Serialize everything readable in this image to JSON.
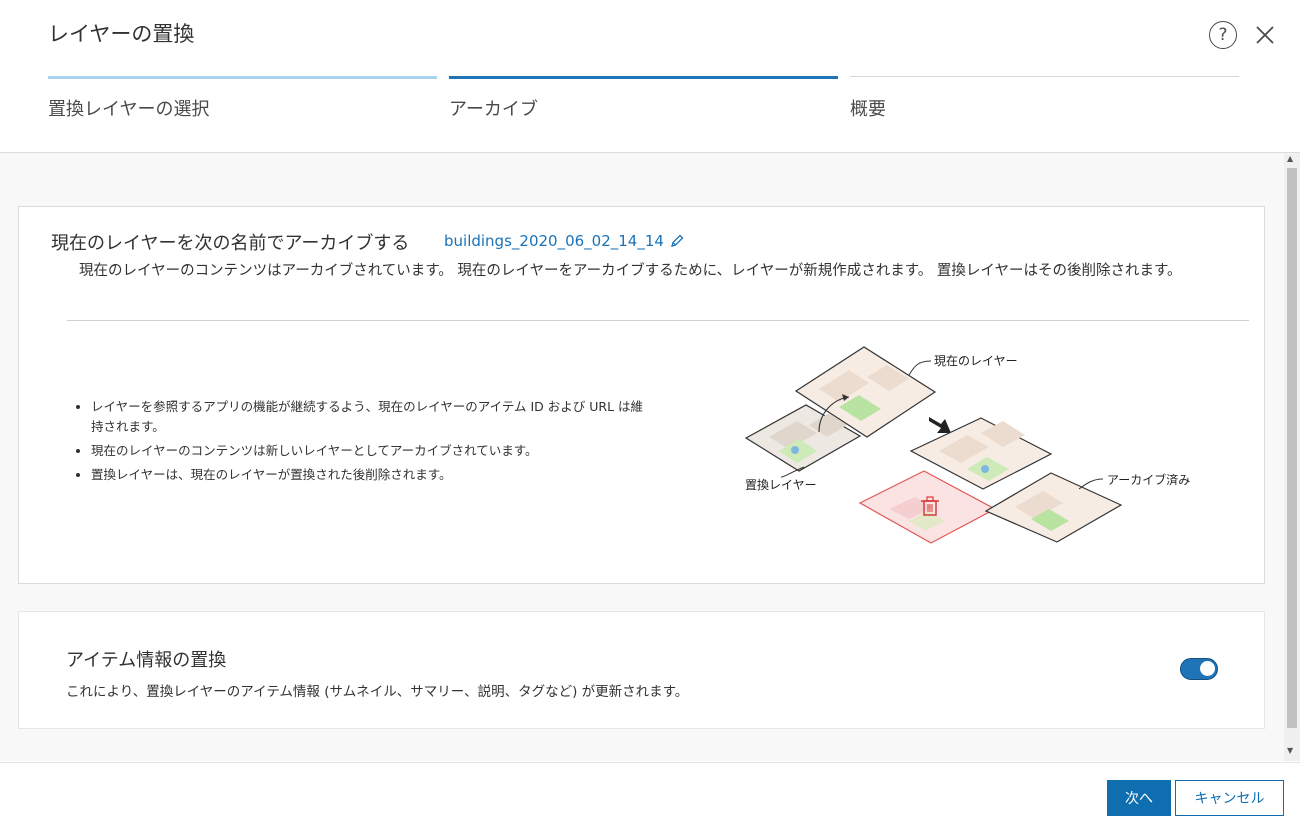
{
  "dialog": {
    "title": "レイヤーの置換"
  },
  "steps": [
    {
      "label": "置換レイヤーの選択",
      "state": "completed"
    },
    {
      "label": "アーカイブ",
      "state": "active"
    },
    {
      "label": "概要",
      "state": "pending"
    }
  ],
  "archive": {
    "heading": "現在のレイヤーを次の名前でアーカイブする",
    "name": "buildings_2020_06_02_14_14",
    "description": "現在のレイヤーのコンテンツはアーカイブされています。 現在のレイヤーをアーカイブするために、レイヤーが新規作成されます。 置換レイヤーはその後削除されます。",
    "bullets": [
      "レイヤーを参照するアプリの機能が継続するよう、現在のレイヤーのアイテム ID および URL は維持されます。",
      "現在のレイヤーのコンテンツは新しいレイヤーとしてアーカイブされています。",
      "置換レイヤーは、現在のレイヤーが置換された後削除されます。"
    ],
    "illustration": {
      "label_current": "現在のレイヤー",
      "label_replacement": "置換レイヤー",
      "label_archived": "アーカイブ済み"
    }
  },
  "item_info": {
    "title": "アイテム情報の置換",
    "description": "これにより、置換レイヤーのアイテム情報 (サムネイル、サマリー、説明、タグなど) が更新されます。",
    "toggle_on": true
  },
  "footer": {
    "next_label": "次へ",
    "cancel_label": "キャンセル"
  },
  "colors": {
    "accent": "#0e6eb0",
    "step_completed": "#a9d2ee",
    "step_active": "#1f73b7",
    "step_pending": "#d6d6d6"
  }
}
